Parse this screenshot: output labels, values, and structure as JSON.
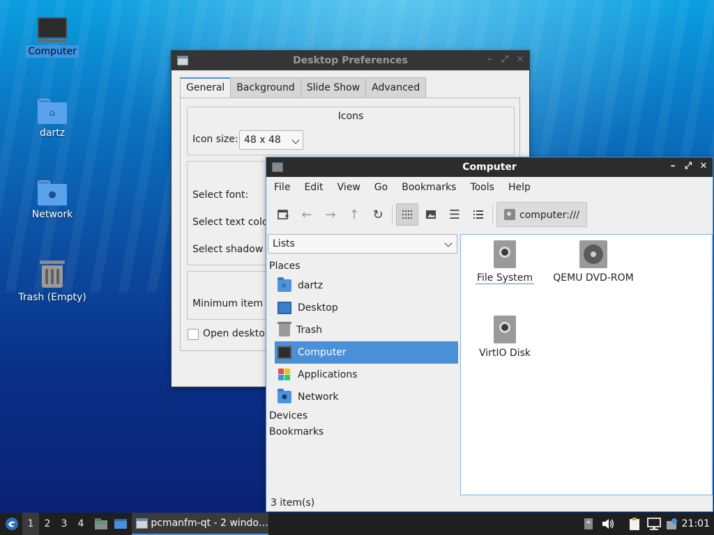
{
  "desktop": {
    "icons": [
      {
        "label": "Computer",
        "kind": "computer-icon"
      },
      {
        "label": "dartz",
        "kind": "home-folder-icon"
      },
      {
        "label": "Network",
        "kind": "network-folder-icon"
      },
      {
        "label": "Trash (Empty)",
        "kind": "trash-icon"
      }
    ]
  },
  "prefs": {
    "title": "Desktop Preferences",
    "tabs": [
      "General",
      "Background",
      "Slide Show",
      "Advanced"
    ],
    "icons_group_title": "Icons",
    "icon_size_label": "Icon size:",
    "icon_size_value": "48 x 48",
    "select_font_label": "Select font:",
    "select_text_color_label": "Select text colo",
    "select_shadow_label": "Select shadow c",
    "minimum_item_label": "Minimum item m",
    "open_desktop_label": "Open desktop"
  },
  "fm": {
    "title": "Computer",
    "menu": [
      "File",
      "Edit",
      "View",
      "Go",
      "Bookmarks",
      "Tools",
      "Help"
    ],
    "path": "computer:///",
    "side_mode": "Lists",
    "places_header": "Places",
    "places": [
      {
        "label": "dartz",
        "icon": "home-folder-icon"
      },
      {
        "label": "Desktop",
        "icon": "desktop-icon"
      },
      {
        "label": "Trash",
        "icon": "trash-icon"
      },
      {
        "label": "Computer",
        "icon": "computer-icon",
        "selected": true
      },
      {
        "label": "Applications",
        "icon": "applications-icon"
      },
      {
        "label": "Network",
        "icon": "network-folder-icon"
      }
    ],
    "devices_header": "Devices",
    "bookmarks_header": "Bookmarks",
    "items": [
      {
        "label": "File System",
        "icon": "hard-disk-icon"
      },
      {
        "label": "QEMU DVD-ROM",
        "icon": "optical-drive-icon"
      },
      {
        "label": "VirtIO Disk",
        "icon": "hard-disk-icon"
      }
    ],
    "status": "3 item(s)"
  },
  "taskbar": {
    "desktops": [
      "1",
      "2",
      "3",
      "4"
    ],
    "task_label": "pcmanfm-qt - 2 windo…",
    "clock": "21:01"
  },
  "colors": {
    "accent": "#4a90d9",
    "titlebar": "#2c2c2c",
    "taskbar": "#1f1f1f"
  }
}
